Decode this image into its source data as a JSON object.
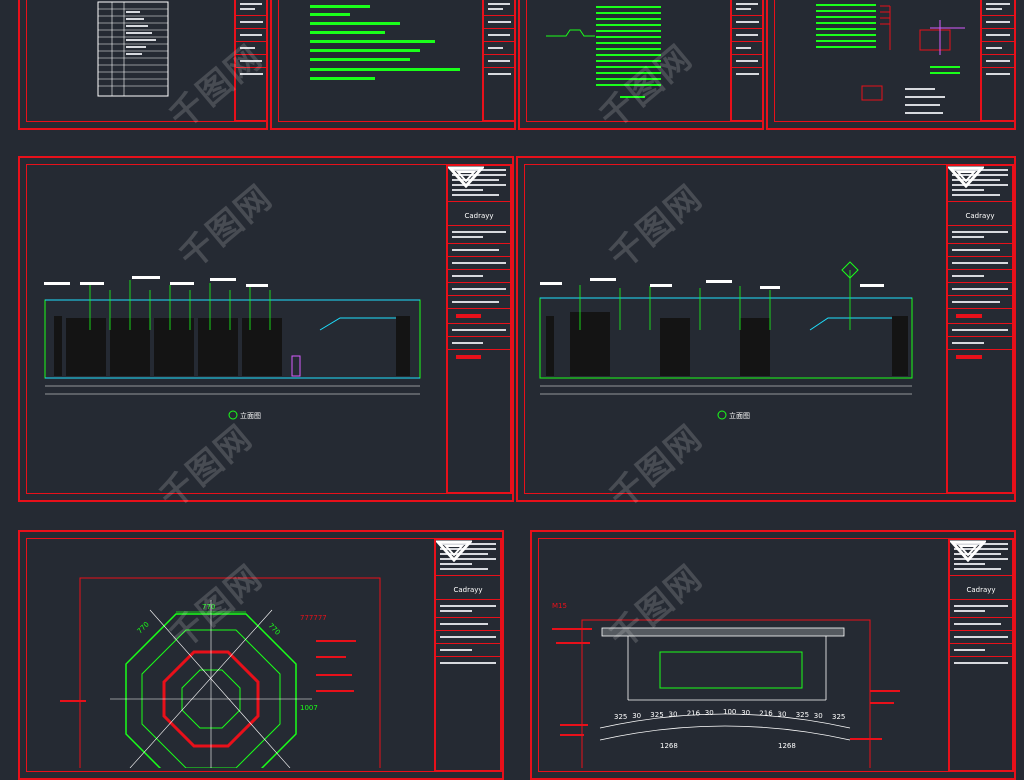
{
  "titleblock": {
    "brand": "Cadrayy"
  },
  "elevation_sheet": {
    "view_label_left": "立面图",
    "view_label_right": "立面图"
  },
  "plan_dimensions": {
    "top": "770",
    "left_slant": "770",
    "right_slant": "770",
    "inner": "1007",
    "tag_right": "777777"
  },
  "section_dimensions": {
    "row1": [
      "325",
      "30",
      "325",
      "30",
      "216",
      "30",
      "100",
      "30",
      "216",
      "30",
      "325",
      "30",
      "325"
    ],
    "left_total": "1268",
    "right_total": "1268",
    "top_label": "M15"
  },
  "colors": {
    "background": "#252a33",
    "frame": "#e8101a",
    "annotation": "#1aff1a",
    "dimension": "#ffffff",
    "accent": "#e8101a"
  }
}
